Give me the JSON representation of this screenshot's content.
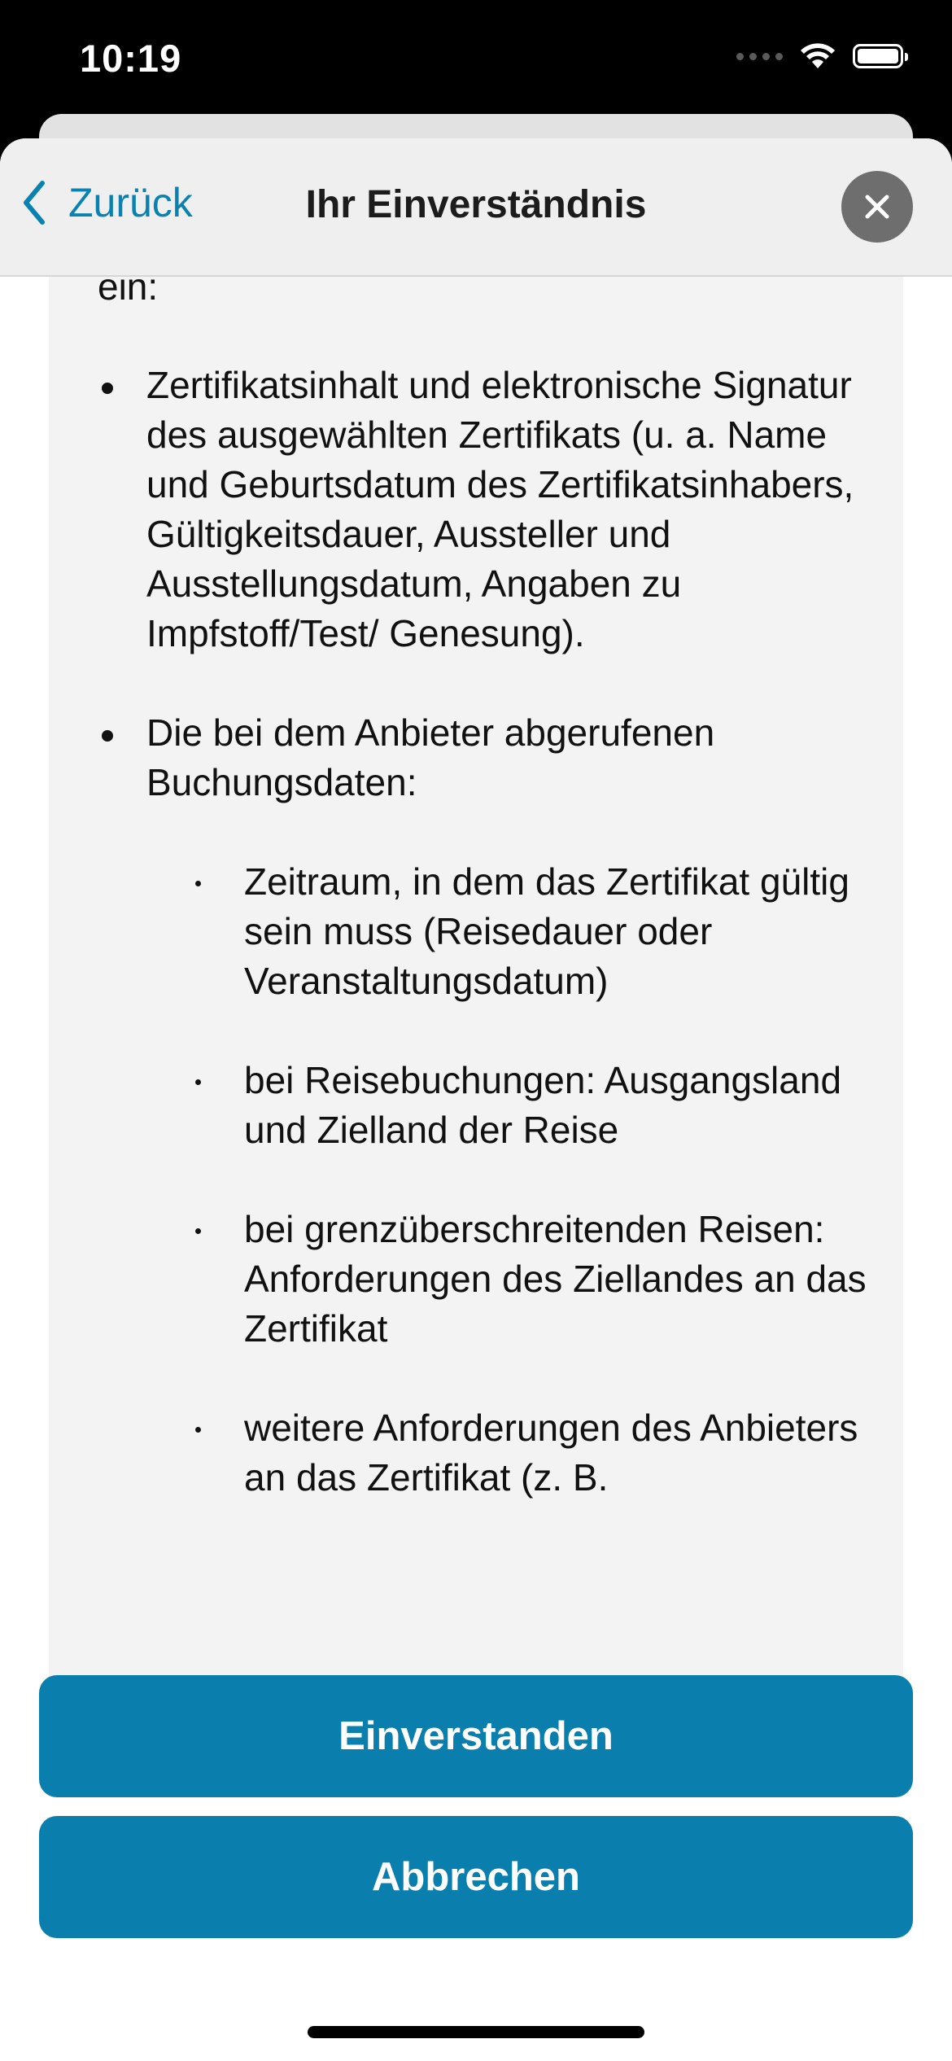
{
  "status_bar": {
    "time": "10:19",
    "icons": [
      "cellular-signal-icon",
      "wifi-icon",
      "battery-icon"
    ]
  },
  "nav": {
    "back_label": "Zurück",
    "title": "Ihr Einverständnis",
    "close_icon": "close-icon"
  },
  "content": {
    "intro_tail": "ein:",
    "bullets": [
      "Zertifikatsinhalt und elektronische Signatur des ausgewählten Zertifikats (u. a. Name und Geburtsdatum des Zertifikatsinhabers, Gültigkeitsdauer, Aussteller und Ausstellungsdatum, Angaben zu Impfstoff/Test/ Genesung).",
      "Die bei dem Anbieter abgerufenen Buchungsdaten:"
    ],
    "sub_bullets": [
      "Zeitraum, in dem das Zertifikat gültig sein muss (Reisedauer oder Veranstaltungsdatum)",
      "bei Reisebuchungen: Ausgangsland und Zielland der Reise",
      "bei grenzüberschreitenden Reisen: Anforderungen des Ziellandes an das Zertifikat",
      "weitere Anforderungen des Anbieters an das Zertifikat (z. B."
    ]
  },
  "actions": {
    "agree_label": "Einverstanden",
    "cancel_label": "Abbrechen"
  },
  "colors": {
    "accent": "#0a7fae",
    "link": "#0a82b0",
    "nav_background": "#efefef",
    "content_background": "#f3f3f3",
    "close_button": "#6e6e6e"
  }
}
